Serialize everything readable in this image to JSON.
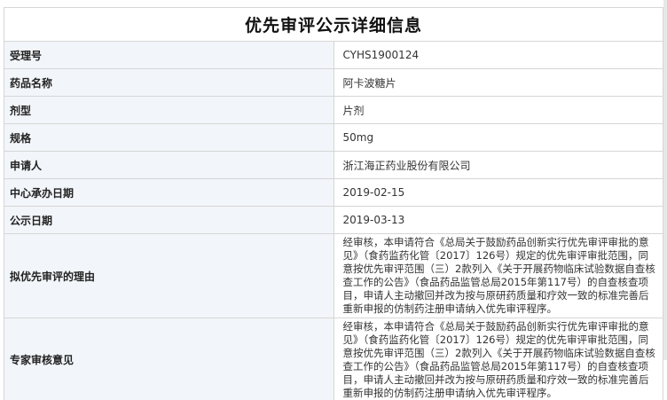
{
  "page": {
    "title": "优先审评公示详细信息"
  },
  "rows": [
    {
      "label": "受理号",
      "value": "CYHS1900124"
    },
    {
      "label": "药品名称",
      "value": "阿卡波糖片"
    },
    {
      "label": "剂型",
      "value": "片剂"
    },
    {
      "label": "规格",
      "value": "50mg"
    },
    {
      "label": "申请人",
      "value": "浙江海正药业股份有限公司"
    },
    {
      "label": "中心承办日期",
      "value": "2019-02-15"
    },
    {
      "label": "公示日期",
      "value": "2019-03-13"
    },
    {
      "label": "拟优先审评的理由",
      "value": "经审核，本申请符合《总局关于鼓励药品创新实行优先审评审批的意见》（食药监药化管〔2017〕126号）规定的优先审评审批范围，同意按优先审评范围（三）2款列入《关于开展药物临床试验数据自查核查工作的公告》（食品药品监管总局2015年第117号）的自查核查项目，申请人主动撤回并改为按与原研药质量和疗效一致的标准完善后重新申报的仿制药注册申请纳入优先审评程序。"
    },
    {
      "label": "专家审核意见",
      "value": "经审核，本申请符合《总局关于鼓励药品创新实行优先审评审批的意见》（食药监药化管〔2017〕126号）规定的优先审评审批范围，同意按优先审评范围（三）2款列入《关于开展药物临床试验数据自查核查工作的公告》（食品药品监管总局2015年第117号）的自查核查项目，申请人主动撤回并改为按与原研药质量和疗效一致的标准完善后重新申报的仿制药注册申请纳入优先审评程序。"
    }
  ],
  "colors": {
    "label_bg": "#f2f5f9",
    "border": "#d6d6d6"
  }
}
